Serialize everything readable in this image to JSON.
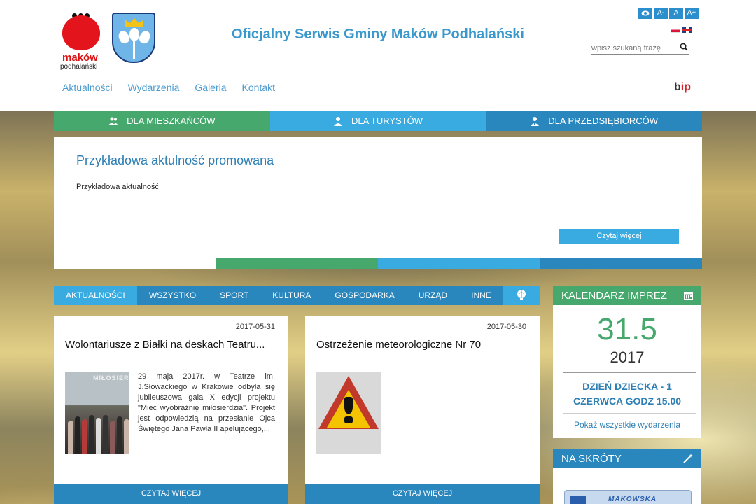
{
  "header": {
    "logo_main": "maków",
    "logo_sub": "podhalański",
    "title": "Oficjalny Serwis Gminy Maków Podhalański",
    "accessibility": [
      "A-",
      "A",
      "A+"
    ],
    "search_placeholder": "wpisz szukaną frazę",
    "nav": [
      "Aktualności",
      "Wydarzenia",
      "Galeria",
      "Kontakt"
    ],
    "bip_prefix": "b",
    "bip_suffix": "ip"
  },
  "category_tabs": [
    {
      "label": "DLA MIESZKAŃCÓW",
      "color": "#47a86e",
      "icon": "residents-icon"
    },
    {
      "label": "DLA TURYSTÓW",
      "color": "#3aabe0",
      "icon": "tourist-icon"
    },
    {
      "label": "DLA PRZEDSIĘBIORCÓW",
      "color": "#2a87be",
      "icon": "business-icon"
    }
  ],
  "promo": {
    "title": "Przykładowa aktulność promowana",
    "text": "Przykładowa aktualność",
    "button": "Czytaj więcej",
    "bar_colors": [
      "#ffffff",
      "#47a86e",
      "#3aabe0",
      "#2a87be"
    ]
  },
  "news_tabs": {
    "active": "AKTUALNOŚCI",
    "items": [
      "WSZYSTKO",
      "SPORT",
      "KULTURA",
      "GOSPODARKA",
      "URZĄD",
      "INNE"
    ],
    "icon": "balloon-icon"
  },
  "cards": [
    {
      "date": "2017-05-31",
      "title": "Wolontariusze z Białki na deskach Teatru...",
      "image_caption": "MIŁOSIERDZIA",
      "excerpt": "29 maja 2017r. w Teatrze im. J.Słowackiego w Krakowie odbyła się jubileuszowa gala X edycji projektu \"Mieć wyobraźnię miłosierdzia\". Projekt jest odpowiedzią na przesłanie Ojca Świętego Jana Pawła II apelującego,...",
      "read_more": "CZYTAJ WIĘCEJ"
    },
    {
      "date": "2017-05-30",
      "title": "Ostrzeżenie meteorologiczne Nr 70",
      "excerpt": "",
      "read_more": "CZYTAJ WIĘCEJ"
    }
  ],
  "calendar": {
    "title": "KALENDARZ IMPREZ",
    "day": "31.5",
    "year": "2017",
    "event": "DZIEŃ DZIECKA - 1 CZERWCA GODZ 15.00",
    "all_link": "Pokaż wszystkie wydarzenia"
  },
  "shortcuts": {
    "title": "NA SKRÓTY",
    "banner_text": "MAKOWSKA"
  },
  "colors": {
    "green": "#47a86e",
    "light_blue": "#3aabe0",
    "dark_blue": "#2a87be",
    "title_blue": "#3a98cc"
  }
}
